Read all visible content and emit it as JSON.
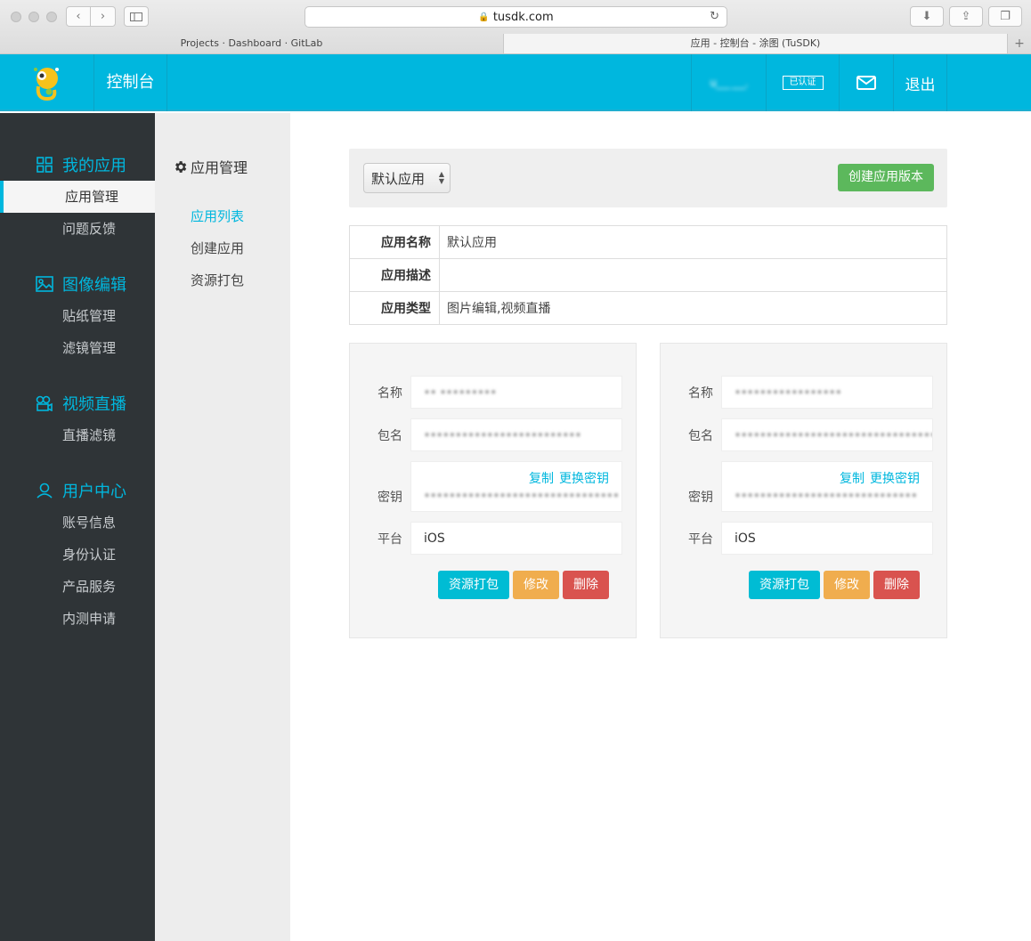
{
  "browser": {
    "url": "tusdk.com",
    "tabs": [
      "Projects · Dashboard · GitLab",
      "应用 - 控制台 - 涂图 (TuSDK)"
    ],
    "new_tab": "+"
  },
  "header": {
    "app_name": "控制台",
    "user": "u___ ___.",
    "verified_badge": "已认证",
    "logout": "退出",
    "accent_color": "#00b7de"
  },
  "sidebar": {
    "groups": [
      {
        "title": "我的应用",
        "icon": "grid-icon",
        "items": [
          "应用管理",
          "问题反馈"
        ]
      },
      {
        "title": "图像编辑",
        "icon": "image-icon",
        "items": [
          "贴纸管理",
          "滤镜管理"
        ]
      },
      {
        "title": "视频直播",
        "icon": "video-camera-icon",
        "items": [
          "直播滤镜"
        ]
      },
      {
        "title": "用户中心",
        "icon": "user-icon",
        "items": [
          "账号信息",
          "身份认证",
          "产品服务",
          "内测申请"
        ]
      }
    ],
    "active_item": "应用管理"
  },
  "subnav": {
    "title": "应用管理",
    "items": [
      "应用列表",
      "创建应用",
      "资源打包"
    ],
    "active_item": "应用列表"
  },
  "toolbar": {
    "select_value": "默认应用",
    "create_button": "创建应用版本"
  },
  "app_info": {
    "rows": [
      {
        "key": "应用名称",
        "value": "默认应用"
      },
      {
        "key": "应用描述",
        "value": ""
      },
      {
        "key": "应用类型",
        "value": "图片编辑,视频直播"
      }
    ]
  },
  "cards": [
    {
      "labels": {
        "name": "名称",
        "package": "包名",
        "key": "密钥",
        "platform": "平台"
      },
      "name": "•• •••••••••",
      "package": "•••••••••••••••••••••••••",
      "key": "•••••••••••••••••••••••••••••••",
      "copy_link": "复制",
      "change_key_link": "更换密钥",
      "platform": "iOS",
      "buttons": {
        "pack": "资源打包",
        "edit": "修改",
        "delete": "删除"
      }
    },
    {
      "labels": {
        "name": "名称",
        "package": "包名",
        "key": "密钥",
        "platform": "平台"
      },
      "name": "•••••••••••••••••",
      "package": "••••••••••••••••••••••••••••••••...",
      "key": "•••••••••••••••••••••••••••••",
      "copy_link": "复制",
      "change_key_link": "更换密钥",
      "platform": "iOS",
      "buttons": {
        "pack": "资源打包",
        "edit": "修改",
        "delete": "删除"
      }
    }
  ]
}
